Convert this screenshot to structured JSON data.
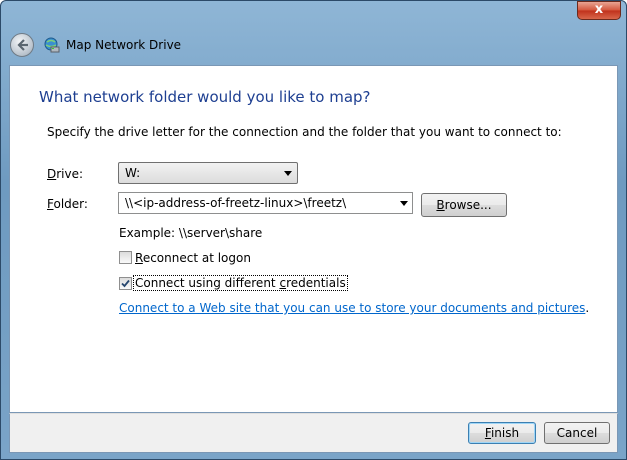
{
  "window": {
    "title": "Map Network Drive",
    "close_label": "x"
  },
  "heading": "What network folder would you like to map?",
  "instruction": "Specify the drive letter for the connection and the folder that you want to connect to:",
  "drive": {
    "label_mnemonic": "D",
    "label_rest": "rive:",
    "selected": "W:"
  },
  "folder": {
    "label_mnemonic": "F",
    "label_rest": "older:",
    "value": "\\\\<ip-address-of-freetz-linux>\\freetz\\"
  },
  "browse": {
    "mnemonic": "B",
    "rest": "rowse..."
  },
  "example": "Example: \\\\server\\share",
  "reconnect": {
    "mnemonic": "R",
    "rest": "econnect at logon",
    "checked": false
  },
  "credentials": {
    "prefix": "Connect using different ",
    "mnemonic": "c",
    "rest": "redentials",
    "checked": true
  },
  "link": {
    "text": "Connect to a Web site that you can use to store your documents and pictures",
    "suffix": "."
  },
  "buttons": {
    "finish_mnemonic": "F",
    "finish_rest": "inish",
    "cancel": "Cancel"
  }
}
